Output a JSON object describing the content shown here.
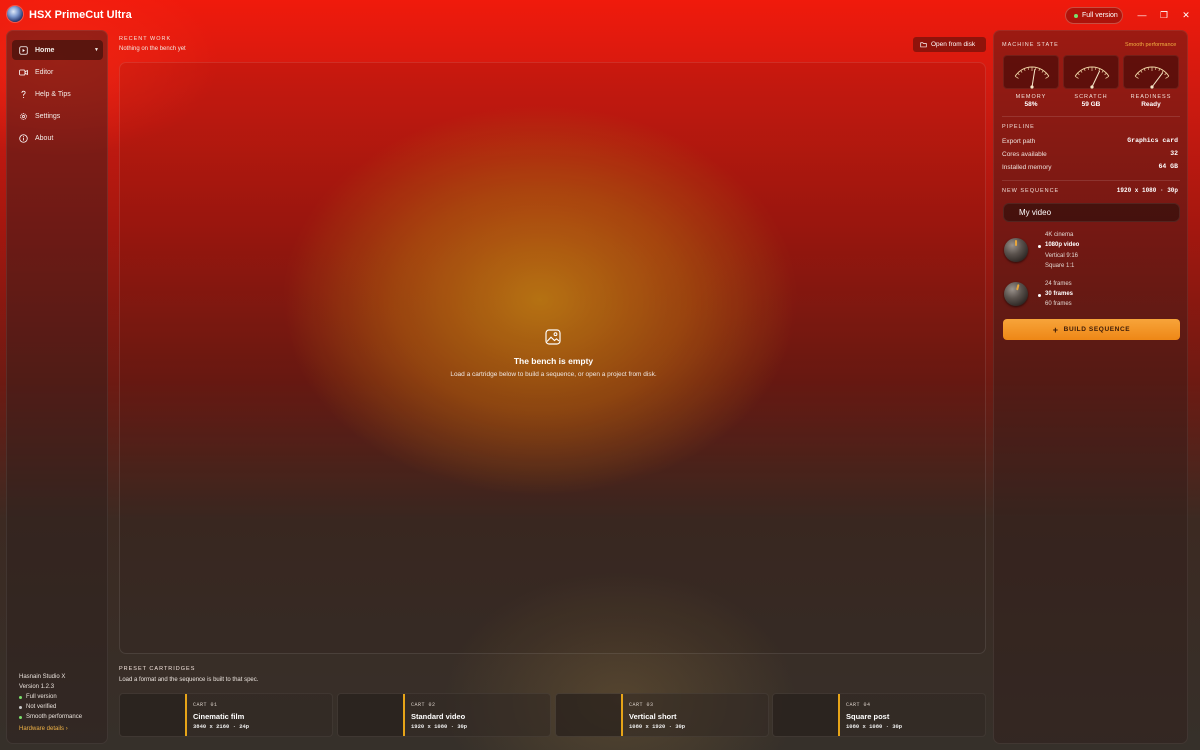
{
  "app": {
    "title": "HSX PrimeCut Ultra",
    "version_pill": "Full version"
  },
  "window_controls": {
    "minimize": "—",
    "restore": "❐",
    "close": "✕"
  },
  "sidebar": {
    "items": [
      {
        "label": "Home",
        "icon": "home-icon",
        "active": true
      },
      {
        "label": "Editor",
        "icon": "video-icon",
        "active": false
      },
      {
        "label": "Help & Tips",
        "icon": "question-icon",
        "active": false
      },
      {
        "label": "Settings",
        "icon": "gear-icon",
        "active": false
      },
      {
        "label": "About",
        "icon": "info-icon",
        "active": false
      }
    ],
    "footer": {
      "studio": "Hasnain Studio X",
      "version": "Version 1.2.3",
      "badges": [
        {
          "label": "Full version",
          "color": "#7be06c"
        },
        {
          "label": "Not verified",
          "color": "#c9c9c9"
        },
        {
          "label": "Smooth performance",
          "color": "#7be06c"
        }
      ],
      "hardware_link": "Hardware details ›"
    }
  },
  "recent": {
    "label": "RECENT WORK",
    "subtitle": "Nothing on the bench yet",
    "open_button": "Open from disk"
  },
  "bench": {
    "title": "The bench is empty",
    "description": "Load a cartridge below to build a sequence, or open a project from disk."
  },
  "presets": {
    "label": "PRESET CARTRIDGES",
    "subtitle": "Load a format and the sequence is built to that spec.",
    "cartridges": [
      {
        "num": "CART 01",
        "name": "Cinematic film",
        "spec": "3840 x 2160  ·  24p"
      },
      {
        "num": "CART 02",
        "name": "Standard video",
        "spec": "1920 x 1080  ·  30p"
      },
      {
        "num": "CART 03",
        "name": "Vertical short",
        "spec": "1080 x 1920  ·  30p"
      },
      {
        "num": "CART 04",
        "name": "Square post",
        "spec": "1080 x 1080  ·  30p"
      }
    ]
  },
  "machine": {
    "label": "MACHINE STATE",
    "status": "Smooth performance",
    "gauges": [
      {
        "label": "MEMORY",
        "value": "58%",
        "level": 0.58
      },
      {
        "label": "SCRATCH",
        "value": "59 GB",
        "level": 0.72
      },
      {
        "label": "READINESS",
        "value": "Ready",
        "level": 0.82
      }
    ]
  },
  "pipeline": {
    "label": "PIPELINE",
    "rows": [
      {
        "key": "Export path",
        "value": "Graphics card"
      },
      {
        "key": "Cores available",
        "value": "32"
      },
      {
        "key": "Installed memory",
        "value": "64 GB"
      }
    ]
  },
  "new_sequence": {
    "label": "NEW SEQUENCE",
    "spec": "1920 x 1080 · 30p",
    "name_value": "My video",
    "resolution_options": [
      "4K cinema",
      "1080p video",
      "Vertical 9:16",
      "Square 1:1"
    ],
    "resolution_selected": 1,
    "frame_options": [
      "24 frames",
      "30 frames",
      "60 frames"
    ],
    "frame_selected": 1,
    "build_button": "BUILD SEQUENCE"
  },
  "colors": {
    "accent": "#f39a2a",
    "cart_bar": "#e6a418",
    "brand_red": "#f01a0c"
  }
}
